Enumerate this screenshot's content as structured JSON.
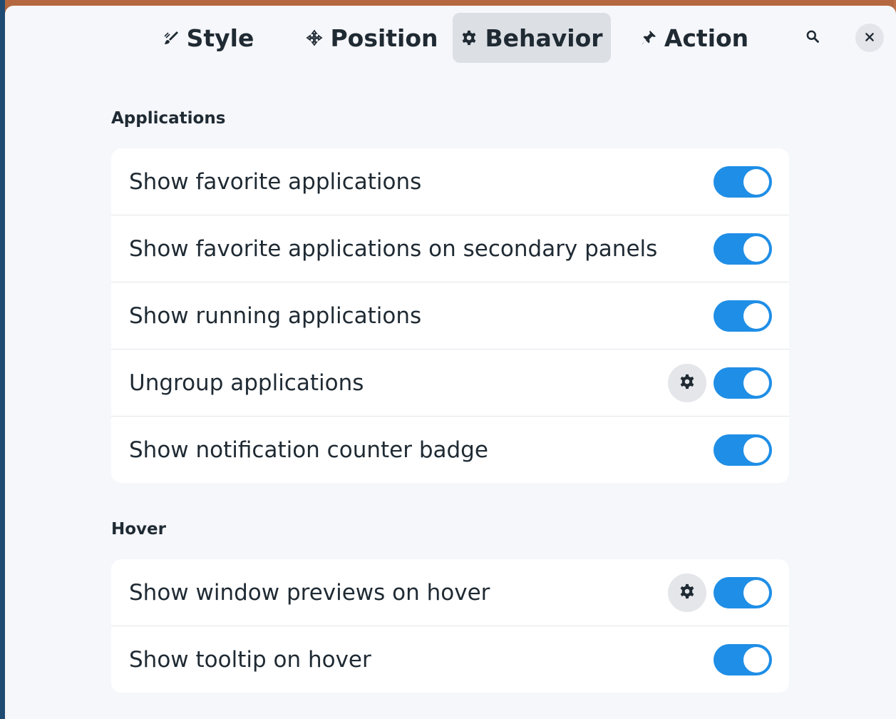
{
  "colors": {
    "accent": "#1f8ee6",
    "window_bg": "#f6f7fb",
    "card_bg": "#ffffff",
    "text": "#1f2a33",
    "active_tab_bg": "#dcdfe4"
  },
  "header": {
    "tabs": [
      {
        "label": "Style",
        "icon": "brush-icon",
        "active": false
      },
      {
        "label": "Position",
        "icon": "move-icon",
        "active": false
      },
      {
        "label": "Behavior",
        "icon": "gear-icon",
        "active": true
      },
      {
        "label": "Action",
        "icon": "pin-icon",
        "active": false
      }
    ],
    "search_icon": "search-icon",
    "close_icon": "close-icon"
  },
  "sections": {
    "applications": {
      "title": "Applications",
      "rows": [
        {
          "label": "Show favorite applications",
          "enabled": true,
          "has_settings": false
        },
        {
          "label": "Show favorite applications on secondary panels",
          "enabled": true,
          "has_settings": false
        },
        {
          "label": "Show running applications",
          "enabled": true,
          "has_settings": false
        },
        {
          "label": "Ungroup applications",
          "enabled": true,
          "has_settings": true
        },
        {
          "label": "Show notification counter badge",
          "enabled": true,
          "has_settings": false
        }
      ]
    },
    "hover": {
      "title": "Hover",
      "rows": [
        {
          "label": "Show window previews on hover",
          "enabled": true,
          "has_settings": true
        },
        {
          "label": "Show tooltip on hover",
          "enabled": true,
          "has_settings": false
        }
      ]
    }
  }
}
